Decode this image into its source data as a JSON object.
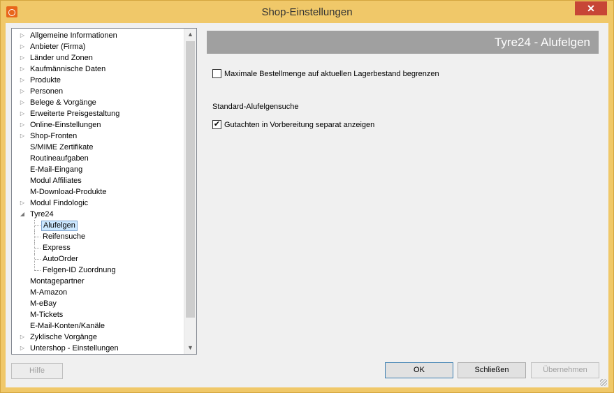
{
  "window": {
    "title": "Shop-Einstellungen",
    "close_symbol": "✕"
  },
  "tree": {
    "items": [
      {
        "label": "Allgemeine Informationen",
        "level": 0,
        "expander": "closed"
      },
      {
        "label": "Anbieter (Firma)",
        "level": 0,
        "expander": "closed"
      },
      {
        "label": "Länder und Zonen",
        "level": 0,
        "expander": "closed"
      },
      {
        "label": "Kaufmännische Daten",
        "level": 0,
        "expander": "closed"
      },
      {
        "label": "Produkte",
        "level": 0,
        "expander": "closed"
      },
      {
        "label": "Personen",
        "level": 0,
        "expander": "closed"
      },
      {
        "label": "Belege & Vorgänge",
        "level": 0,
        "expander": "closed"
      },
      {
        "label": "Erweiterte Preisgestaltung",
        "level": 0,
        "expander": "closed"
      },
      {
        "label": "Online-Einstellungen",
        "level": 0,
        "expander": "closed"
      },
      {
        "label": "Shop-Fronten",
        "level": 0,
        "expander": "closed"
      },
      {
        "label": "S/MIME Zertifikate",
        "level": 0,
        "expander": "none"
      },
      {
        "label": "Routineaufgaben",
        "level": 0,
        "expander": "none"
      },
      {
        "label": "E-Mail-Eingang",
        "level": 0,
        "expander": "none"
      },
      {
        "label": "Modul Affiliates",
        "level": 0,
        "expander": "none"
      },
      {
        "label": "M-Download-Produkte",
        "level": 0,
        "expander": "none"
      },
      {
        "label": "Modul Findologic",
        "level": 0,
        "expander": "closed"
      },
      {
        "label": "Tyre24",
        "level": 0,
        "expander": "open"
      },
      {
        "label": "Alufelgen",
        "level": 1,
        "expander": "none",
        "selected": true
      },
      {
        "label": "Reifensuche",
        "level": 1,
        "expander": "none"
      },
      {
        "label": "Express",
        "level": 1,
        "expander": "none"
      },
      {
        "label": "AutoOrder",
        "level": 1,
        "expander": "none"
      },
      {
        "label": "Felgen-ID Zuordnung",
        "level": 1,
        "expander": "none"
      },
      {
        "label": "Montagepartner",
        "level": 0,
        "expander": "none"
      },
      {
        "label": "M-Amazon",
        "level": 0,
        "expander": "none"
      },
      {
        "label": "M-eBay",
        "level": 0,
        "expander": "none"
      },
      {
        "label": "M-Tickets",
        "level": 0,
        "expander": "none"
      },
      {
        "label": "E-Mail-Konten/Kanäle",
        "level": 0,
        "expander": "none"
      },
      {
        "label": "Zyklische Vorgänge",
        "level": 0,
        "expander": "closed"
      },
      {
        "label": "Untershop - Einstellungen",
        "level": 0,
        "expander": "closed"
      }
    ]
  },
  "panel": {
    "title": "Tyre24 - Alufelgen",
    "checkbox_max_order": {
      "label": "Maximale Bestellmenge auf aktuellen Lagerbestand begrenzen",
      "checked": false
    },
    "section_label": "Standard-Alufelgensuche",
    "checkbox_gutachten": {
      "label": "Gutachten in Vorbereitung separat anzeigen",
      "checked": true
    }
  },
  "buttons": {
    "help": "Hilfe",
    "ok": "OK",
    "close": "Schließen",
    "apply": "Übernehmen"
  },
  "colors": {
    "title_bar": "#f0c869",
    "close_button": "#c74636",
    "header_bar": "#a0a0a0",
    "selection": "#cce8ff"
  }
}
